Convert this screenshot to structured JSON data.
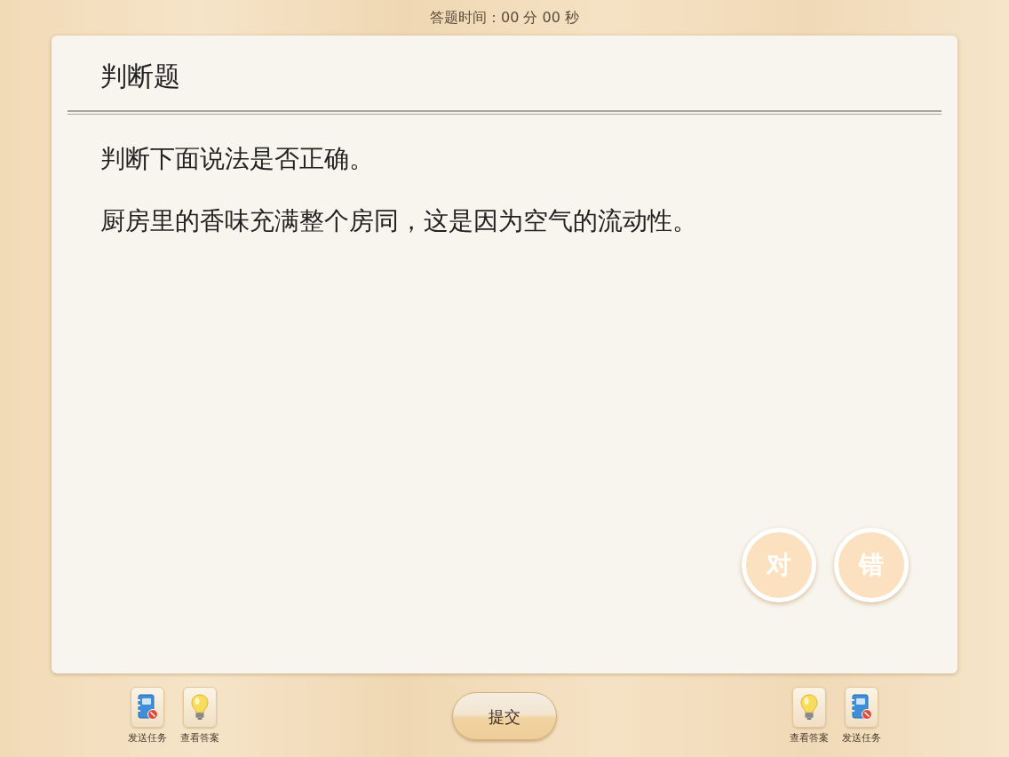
{
  "timer": "答题时间：00 分 00 秒",
  "question": {
    "type_title": "判断题",
    "instruction": "判断下面说法是否正确。",
    "statement": "厨房里的香味充满整个房同，这是因为空气的流动性。"
  },
  "answer_options": [
    {
      "label": "对",
      "selected": false
    },
    {
      "label": "错",
      "selected": false
    }
  ],
  "left_tools": [
    {
      "kind": "send-task",
      "label": "发送任务"
    },
    {
      "kind": "view-answer",
      "label": "查看答案"
    }
  ],
  "submit_button": "提交",
  "right_tools": [
    {
      "kind": "view-answer",
      "label": "查看答案"
    },
    {
      "kind": "send-task",
      "label": "发送任务"
    }
  ]
}
